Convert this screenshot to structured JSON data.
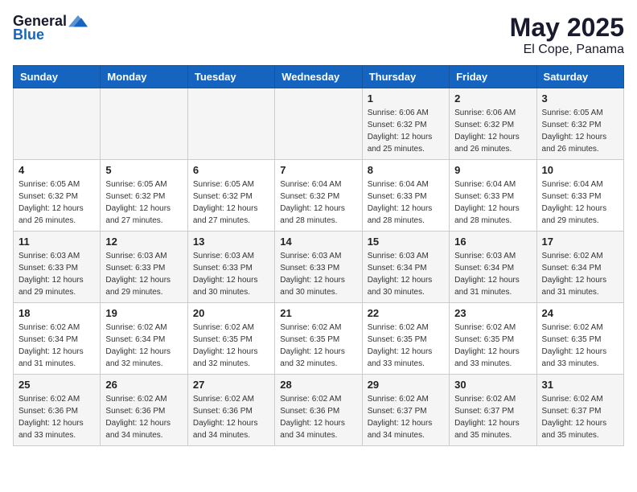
{
  "header": {
    "logo_general": "General",
    "logo_blue": "Blue",
    "title": "May 2025",
    "subtitle": "El Cope, Panama"
  },
  "calendar": {
    "days_of_week": [
      "Sunday",
      "Monday",
      "Tuesday",
      "Wednesday",
      "Thursday",
      "Friday",
      "Saturday"
    ],
    "weeks": [
      [
        {
          "day": "",
          "sunrise": "",
          "sunset": "",
          "daylight": "",
          "empty": true
        },
        {
          "day": "",
          "sunrise": "",
          "sunset": "",
          "daylight": "",
          "empty": true
        },
        {
          "day": "",
          "sunrise": "",
          "sunset": "",
          "daylight": "",
          "empty": true
        },
        {
          "day": "",
          "sunrise": "",
          "sunset": "",
          "daylight": "",
          "empty": true
        },
        {
          "day": "1",
          "sunrise": "Sunrise: 6:06 AM",
          "sunset": "Sunset: 6:32 PM",
          "daylight": "Daylight: 12 hours and 25 minutes.",
          "empty": false
        },
        {
          "day": "2",
          "sunrise": "Sunrise: 6:06 AM",
          "sunset": "Sunset: 6:32 PM",
          "daylight": "Daylight: 12 hours and 26 minutes.",
          "empty": false
        },
        {
          "day": "3",
          "sunrise": "Sunrise: 6:05 AM",
          "sunset": "Sunset: 6:32 PM",
          "daylight": "Daylight: 12 hours and 26 minutes.",
          "empty": false
        }
      ],
      [
        {
          "day": "4",
          "sunrise": "Sunrise: 6:05 AM",
          "sunset": "Sunset: 6:32 PM",
          "daylight": "Daylight: 12 hours and 26 minutes.",
          "empty": false
        },
        {
          "day": "5",
          "sunrise": "Sunrise: 6:05 AM",
          "sunset": "Sunset: 6:32 PM",
          "daylight": "Daylight: 12 hours and 27 minutes.",
          "empty": false
        },
        {
          "day": "6",
          "sunrise": "Sunrise: 6:05 AM",
          "sunset": "Sunset: 6:32 PM",
          "daylight": "Daylight: 12 hours and 27 minutes.",
          "empty": false
        },
        {
          "day": "7",
          "sunrise": "Sunrise: 6:04 AM",
          "sunset": "Sunset: 6:32 PM",
          "daylight": "Daylight: 12 hours and 28 minutes.",
          "empty": false
        },
        {
          "day": "8",
          "sunrise": "Sunrise: 6:04 AM",
          "sunset": "Sunset: 6:33 PM",
          "daylight": "Daylight: 12 hours and 28 minutes.",
          "empty": false
        },
        {
          "day": "9",
          "sunrise": "Sunrise: 6:04 AM",
          "sunset": "Sunset: 6:33 PM",
          "daylight": "Daylight: 12 hours and 28 minutes.",
          "empty": false
        },
        {
          "day": "10",
          "sunrise": "Sunrise: 6:04 AM",
          "sunset": "Sunset: 6:33 PM",
          "daylight": "Daylight: 12 hours and 29 minutes.",
          "empty": false
        }
      ],
      [
        {
          "day": "11",
          "sunrise": "Sunrise: 6:03 AM",
          "sunset": "Sunset: 6:33 PM",
          "daylight": "Daylight: 12 hours and 29 minutes.",
          "empty": false
        },
        {
          "day": "12",
          "sunrise": "Sunrise: 6:03 AM",
          "sunset": "Sunset: 6:33 PM",
          "daylight": "Daylight: 12 hours and 29 minutes.",
          "empty": false
        },
        {
          "day": "13",
          "sunrise": "Sunrise: 6:03 AM",
          "sunset": "Sunset: 6:33 PM",
          "daylight": "Daylight: 12 hours and 30 minutes.",
          "empty": false
        },
        {
          "day": "14",
          "sunrise": "Sunrise: 6:03 AM",
          "sunset": "Sunset: 6:33 PM",
          "daylight": "Daylight: 12 hours and 30 minutes.",
          "empty": false
        },
        {
          "day": "15",
          "sunrise": "Sunrise: 6:03 AM",
          "sunset": "Sunset: 6:34 PM",
          "daylight": "Daylight: 12 hours and 30 minutes.",
          "empty": false
        },
        {
          "day": "16",
          "sunrise": "Sunrise: 6:03 AM",
          "sunset": "Sunset: 6:34 PM",
          "daylight": "Daylight: 12 hours and 31 minutes.",
          "empty": false
        },
        {
          "day": "17",
          "sunrise": "Sunrise: 6:02 AM",
          "sunset": "Sunset: 6:34 PM",
          "daylight": "Daylight: 12 hours and 31 minutes.",
          "empty": false
        }
      ],
      [
        {
          "day": "18",
          "sunrise": "Sunrise: 6:02 AM",
          "sunset": "Sunset: 6:34 PM",
          "daylight": "Daylight: 12 hours and 31 minutes.",
          "empty": false
        },
        {
          "day": "19",
          "sunrise": "Sunrise: 6:02 AM",
          "sunset": "Sunset: 6:34 PM",
          "daylight": "Daylight: 12 hours and 32 minutes.",
          "empty": false
        },
        {
          "day": "20",
          "sunrise": "Sunrise: 6:02 AM",
          "sunset": "Sunset: 6:35 PM",
          "daylight": "Daylight: 12 hours and 32 minutes.",
          "empty": false
        },
        {
          "day": "21",
          "sunrise": "Sunrise: 6:02 AM",
          "sunset": "Sunset: 6:35 PM",
          "daylight": "Daylight: 12 hours and 32 minutes.",
          "empty": false
        },
        {
          "day": "22",
          "sunrise": "Sunrise: 6:02 AM",
          "sunset": "Sunset: 6:35 PM",
          "daylight": "Daylight: 12 hours and 33 minutes.",
          "empty": false
        },
        {
          "day": "23",
          "sunrise": "Sunrise: 6:02 AM",
          "sunset": "Sunset: 6:35 PM",
          "daylight": "Daylight: 12 hours and 33 minutes.",
          "empty": false
        },
        {
          "day": "24",
          "sunrise": "Sunrise: 6:02 AM",
          "sunset": "Sunset: 6:35 PM",
          "daylight": "Daylight: 12 hours and 33 minutes.",
          "empty": false
        }
      ],
      [
        {
          "day": "25",
          "sunrise": "Sunrise: 6:02 AM",
          "sunset": "Sunset: 6:36 PM",
          "daylight": "Daylight: 12 hours and 33 minutes.",
          "empty": false
        },
        {
          "day": "26",
          "sunrise": "Sunrise: 6:02 AM",
          "sunset": "Sunset: 6:36 PM",
          "daylight": "Daylight: 12 hours and 34 minutes.",
          "empty": false
        },
        {
          "day": "27",
          "sunrise": "Sunrise: 6:02 AM",
          "sunset": "Sunset: 6:36 PM",
          "daylight": "Daylight: 12 hours and 34 minutes.",
          "empty": false
        },
        {
          "day": "28",
          "sunrise": "Sunrise: 6:02 AM",
          "sunset": "Sunset: 6:36 PM",
          "daylight": "Daylight: 12 hours and 34 minutes.",
          "empty": false
        },
        {
          "day": "29",
          "sunrise": "Sunrise: 6:02 AM",
          "sunset": "Sunset: 6:37 PM",
          "daylight": "Daylight: 12 hours and 34 minutes.",
          "empty": false
        },
        {
          "day": "30",
          "sunrise": "Sunrise: 6:02 AM",
          "sunset": "Sunset: 6:37 PM",
          "daylight": "Daylight: 12 hours and 35 minutes.",
          "empty": false
        },
        {
          "day": "31",
          "sunrise": "Sunrise: 6:02 AM",
          "sunset": "Sunset: 6:37 PM",
          "daylight": "Daylight: 12 hours and 35 minutes.",
          "empty": false
        }
      ]
    ]
  }
}
